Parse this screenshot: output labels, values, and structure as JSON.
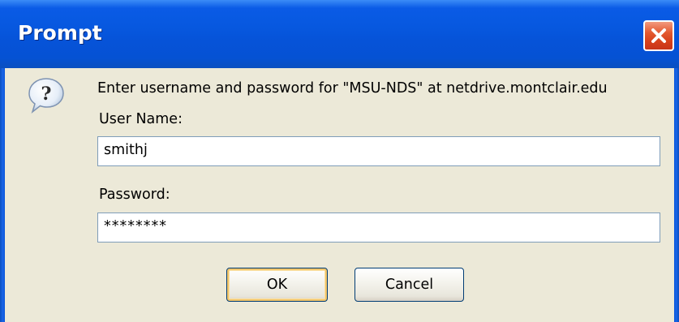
{
  "window": {
    "title": "Prompt",
    "close_icon": "close-icon"
  },
  "dialog": {
    "icon": "question-icon",
    "message": "Enter username and password for \"MSU-NDS\" at netdrive.montclair.edu",
    "username_label": "User Name:",
    "username_value": "smithj",
    "password_label": "Password:",
    "password_value": "********"
  },
  "buttons": {
    "ok_label": "OK",
    "cancel_label": "Cancel"
  },
  "colors": {
    "titlebar": "#0653D8",
    "close_button": "#D7411B",
    "dialog_background": "#ECE9D8"
  }
}
